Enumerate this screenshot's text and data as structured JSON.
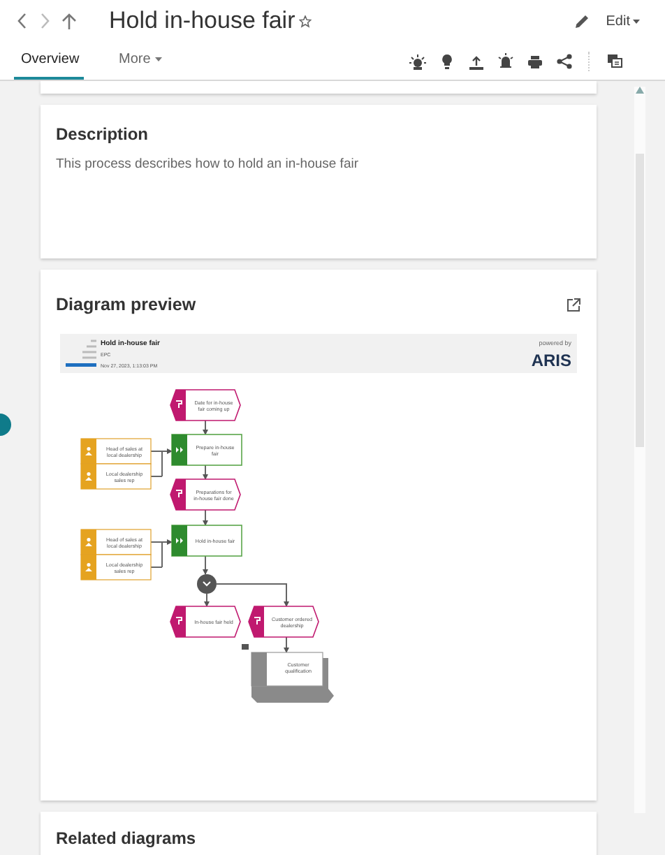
{
  "header": {
    "title": "Hold in-house fair",
    "edit_label": "Edit"
  },
  "tabs": [
    {
      "label": "Overview",
      "selected": true,
      "kind": "tab"
    },
    {
      "label": "More",
      "selected": false,
      "kind": "menu"
    }
  ],
  "description": {
    "title": "Description",
    "text": "This process describes how to hold an in-house fair"
  },
  "diagram_preview": {
    "title": "Diagram preview",
    "sheet": {
      "title": "Hold in-house fair",
      "type": "EPC",
      "date": "Nov 27, 2023, 1:13:03 PM",
      "powered_by": "powered by",
      "logo": "ARIS"
    },
    "nodes": [
      {
        "kind": "event",
        "label": "Date for in-house fair coming up"
      },
      {
        "kind": "org",
        "label": "Head of sales at local dealership"
      },
      {
        "kind": "org",
        "label": "Local dealership sales rep"
      },
      {
        "kind": "function",
        "label": "Prepare in-house fair"
      },
      {
        "kind": "event",
        "label": "Preparations for in-house fair done"
      },
      {
        "kind": "org",
        "label": "Head of sales at local dealership"
      },
      {
        "kind": "org",
        "label": "Local dealership sales rep"
      },
      {
        "kind": "function",
        "label": "Hold in-house fair"
      },
      {
        "kind": "xor"
      },
      {
        "kind": "event",
        "label": "In-house fair held"
      },
      {
        "kind": "event",
        "label": "Customer ordered dealership"
      },
      {
        "kind": "interface",
        "label": "Customer qualification"
      }
    ]
  },
  "related": {
    "title": "Related diagrams"
  }
}
